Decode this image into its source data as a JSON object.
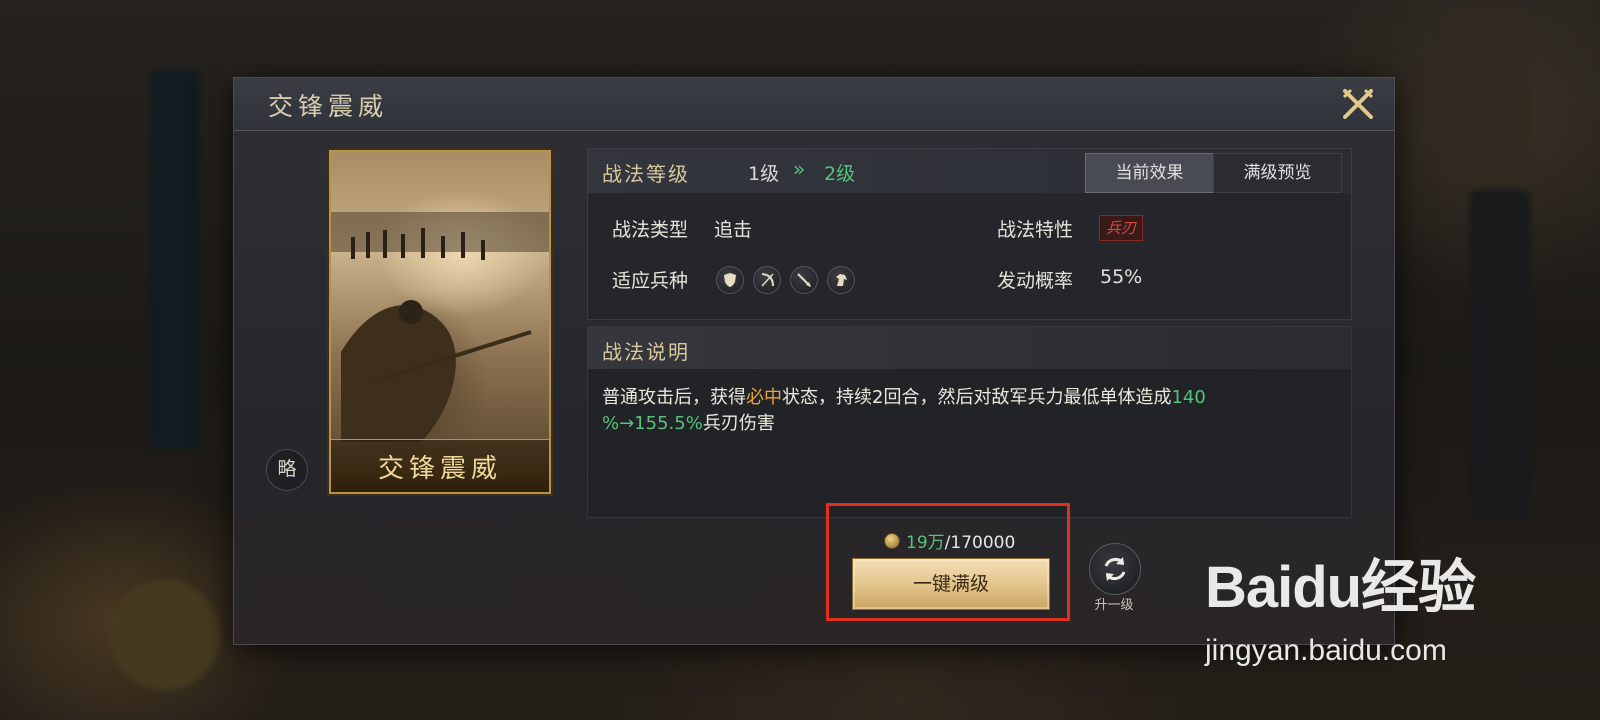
{
  "dialog": {
    "title": "交锋震威",
    "close_icon": "crossed-swords-close-icon"
  },
  "card": {
    "name": "交锋震威",
    "badge": "略"
  },
  "level": {
    "title": "战法等级",
    "from": "1级",
    "arrow": "»",
    "to": "2级"
  },
  "tabs": [
    {
      "label": "当前效果",
      "active": true
    },
    {
      "label": "满级预览",
      "active": false
    }
  ],
  "attributes": {
    "type_label": "战法类型",
    "type_value": "追击",
    "trait_label": "战法特性",
    "trait_value": "兵刃",
    "troops_label": "适应兵种",
    "troop_icons": [
      "shield-troop-icon",
      "bow-troop-icon",
      "spear-troop-icon",
      "horse-troop-icon"
    ],
    "rate_label": "发动概率",
    "rate_value": "55%"
  },
  "description": {
    "title": "战法说明",
    "part1": "普通攻击后，获得",
    "highlight": "必中",
    "part2": "状态，持续2回合，然后对敌军兵力最低单体造成",
    "value_line1": "140",
    "value_line2": "%→155.5%",
    "part3": "兵刃伤害"
  },
  "cost": {
    "have": "19万",
    "sep": "/",
    "need": "170000"
  },
  "buttons": {
    "max_level": "一键满级",
    "upgrade_one": "升一级"
  },
  "watermark": {
    "logo": "Baidu经验",
    "url": "jingyan.baidu.com"
  },
  "colors": {
    "accent_green": "#57c27a",
    "accent_gold": "#e8a33c",
    "highlight_red": "#e0301e",
    "trait_red": "#d24d40"
  }
}
